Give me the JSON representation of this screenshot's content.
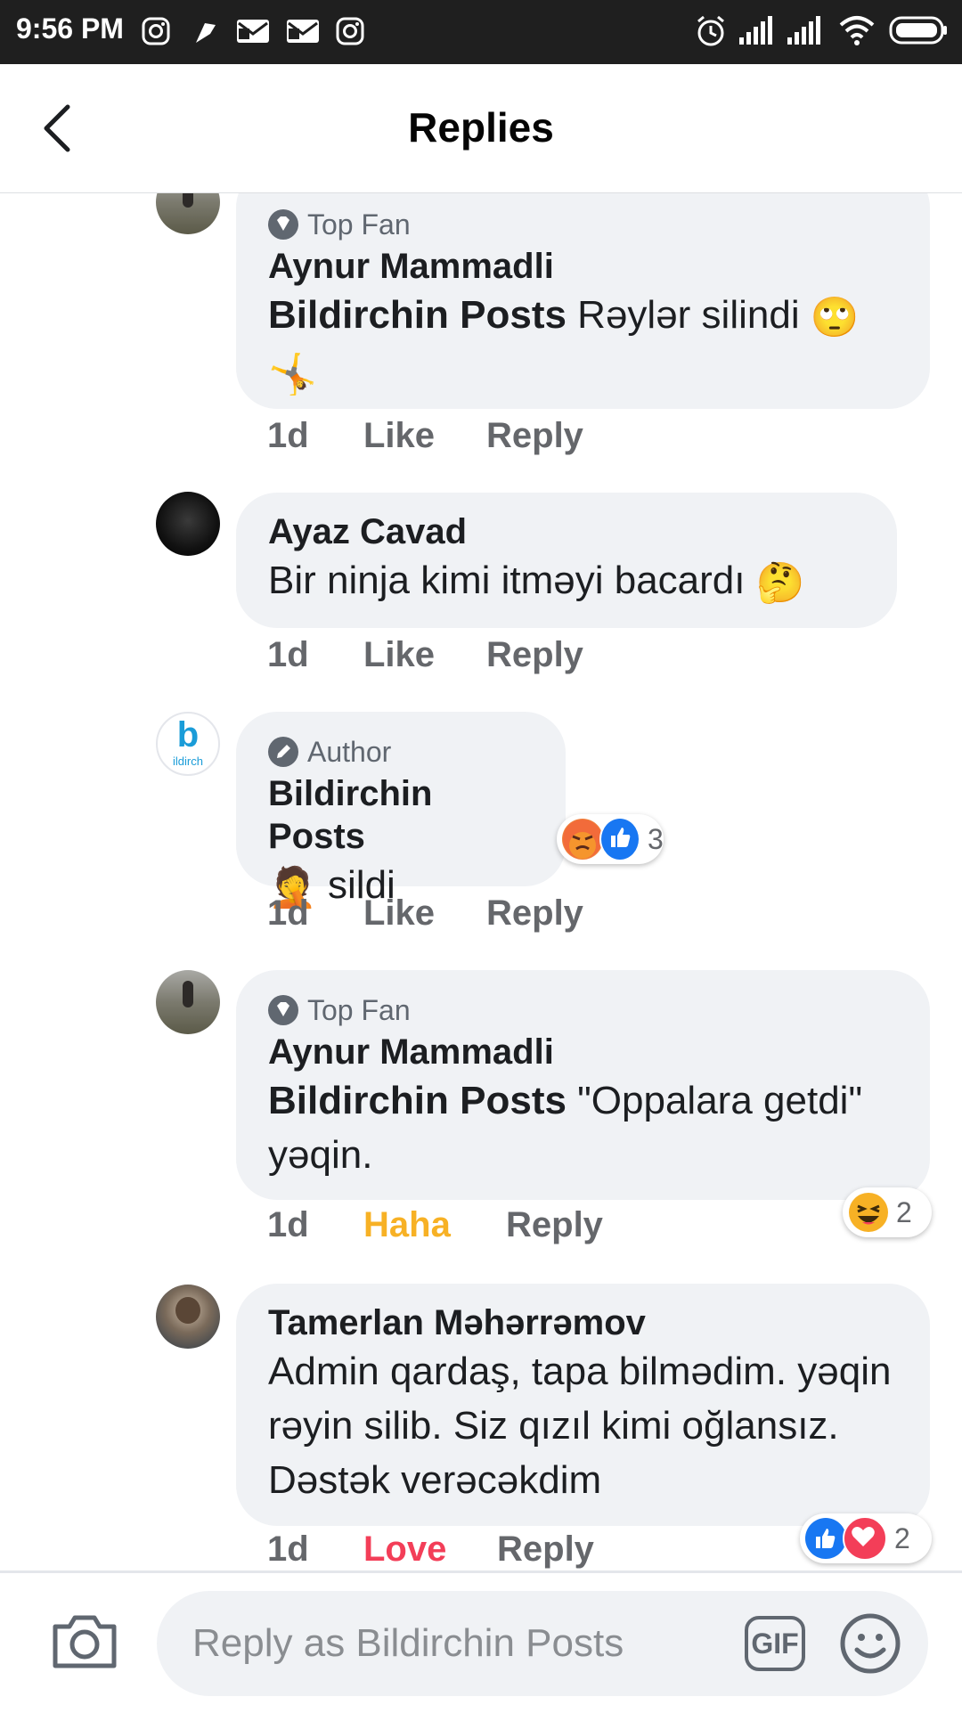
{
  "status_bar": {
    "time": "9:56 PM",
    "icons_left": [
      "instagram-icon",
      "flag-icon",
      "mail-icon",
      "mail-icon",
      "instagram-icon"
    ],
    "icons_right": [
      "alarm-icon",
      "signal-icon",
      "signal-icon",
      "wifi-icon",
      "battery-icon"
    ]
  },
  "header": {
    "title": "Replies"
  },
  "comments": [
    {
      "badge": "Top Fan",
      "name": "Aynur Mammadli",
      "mention": "Bildirchin Posts",
      "text": " Rəylər silindi",
      "emojis": [
        "🙄",
        "🤸"
      ],
      "time": "1d",
      "like": "Like",
      "reply": "Reply"
    },
    {
      "name": "Ayaz Cavad",
      "text": "Bir ninja kimi itməyi bacardı",
      "emojis": [
        "🤔"
      ],
      "time": "1d",
      "like": "Like",
      "reply": "Reply"
    },
    {
      "badge": "Author",
      "name": "Bildirchin Posts",
      "text": "sildi",
      "emojis": [
        "🤦"
      ],
      "time": "1d",
      "like": "Like",
      "reply": "Reply",
      "reaction_count": "3",
      "avatar_letter": "b",
      "avatar_text": "ildirch"
    },
    {
      "badge": "Top Fan",
      "name": "Aynur Mammadli",
      "mention": "Bildirchin Posts",
      "text": " \"Oppalara  getdi\" yəqin.",
      "time": "1d",
      "like": "Haha",
      "reply": "Reply",
      "reaction_count": "2"
    },
    {
      "name": "Tamerlan Məhərrəmov",
      "text": "Admin qardaş, tapa bilmədim. yəqin rəyin silib. Siz qızıl kimi oğlansız. Dəstək verəcəkdim",
      "time": "1d",
      "like": "Love",
      "reply": "Reply",
      "reaction_count": "2"
    }
  ],
  "composer": {
    "placeholder": "Reply as Bildirchin Posts",
    "gif_label": "GIF"
  },
  "colors": {
    "haha": "#f7b125",
    "love": "#f33e58",
    "like_blue": "#1877f2",
    "bubble": "#f0f2f5",
    "muted": "#65676b"
  }
}
